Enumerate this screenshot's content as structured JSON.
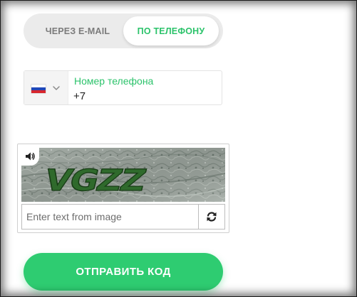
{
  "tabs": {
    "email_label": "ЧЕРЕЗ E-MAIL",
    "phone_label": "ПО ТЕЛЕФОНУ",
    "active": "phone"
  },
  "phone": {
    "country_flag": "flag-ru-icon",
    "label": "Номер телефона",
    "value": "+7"
  },
  "captcha": {
    "image_text": "VGZZ",
    "audio_icon": "speaker-icon",
    "placeholder": "Enter text from image",
    "refresh_icon": "refresh-icon"
  },
  "submit": {
    "label": "ОТПРАВИТЬ КОД"
  },
  "colors": {
    "accent": "#2ecc71",
    "accent_text": "#2cc36b",
    "tab_track": "#ebebeb",
    "inactive_text": "#7b7b7b"
  }
}
